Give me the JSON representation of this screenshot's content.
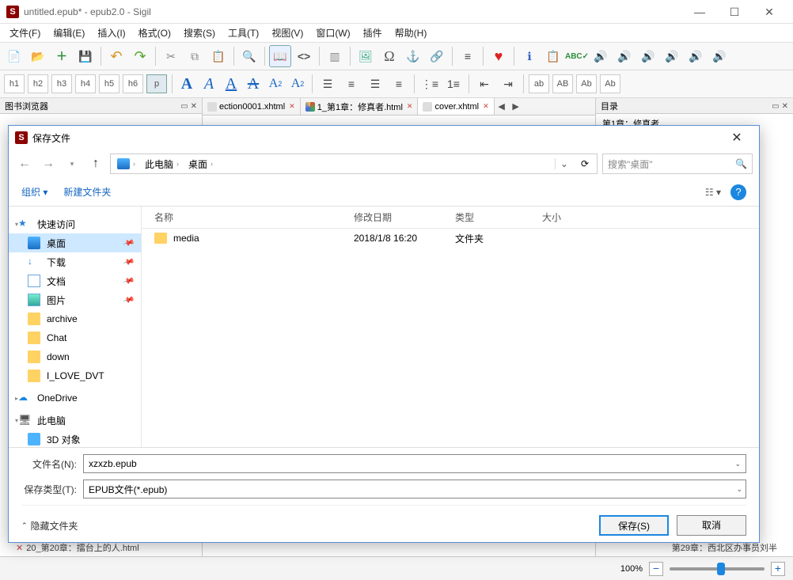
{
  "titlebar": {
    "title": "untitled.epub* - epub2.0 - Sigil",
    "logo": "S"
  },
  "menubar": {
    "file": "文件(F)",
    "edit": "编辑(E)",
    "insert": "插入(I)",
    "format": "格式(O)",
    "search": "搜索(S)",
    "tools": "工具(T)",
    "view": "视图(V)",
    "window": "窗口(W)",
    "plugins": "插件",
    "help": "帮助(H)"
  },
  "headings": {
    "h1": "h1",
    "h2": "h2",
    "h3": "h3",
    "h4": "h4",
    "h5": "h5",
    "h6": "h6",
    "p": "p"
  },
  "panes": {
    "bookbrowser": "图书浏览器",
    "toc": "目录",
    "toc_item": "第1章：修真者"
  },
  "tabs": [
    {
      "label": "ection0001.xhtml",
      "closable": true
    },
    {
      "label": "1_第1章：修真者.html",
      "closable": true
    },
    {
      "label": "cover.xhtml",
      "closable": true,
      "active": true
    }
  ],
  "partial": {
    "left": "20_第20章：擂台上的人.html",
    "right": "第29章：西北区办事员刘半"
  },
  "statusbar": {
    "zoom": "100%"
  },
  "dialog": {
    "title": "保存文件",
    "breadcrumb": {
      "root": "此电脑",
      "folder": "桌面"
    },
    "search_placeholder": "搜索\"桌面\"",
    "toolbar": {
      "organize": "组织",
      "newfolder": "新建文件夹"
    },
    "sidebar": {
      "quickaccess": "快速访问",
      "items": [
        {
          "label": "桌面",
          "icon": "desktop2",
          "pinned": true,
          "selected": true
        },
        {
          "label": "下载",
          "icon": "down",
          "pinned": true
        },
        {
          "label": "文档",
          "icon": "doc",
          "pinned": true
        },
        {
          "label": "图片",
          "icon": "pic",
          "pinned": true
        },
        {
          "label": "archive",
          "icon": "folder"
        },
        {
          "label": "Chat",
          "icon": "folder"
        },
        {
          "label": "down",
          "icon": "folder"
        },
        {
          "label": "I_LOVE_DVT",
          "icon": "folder"
        }
      ],
      "onedrive": "OneDrive",
      "thispc": "此电脑",
      "obj3d": "3D 对象"
    },
    "columns": {
      "name": "名称",
      "modified": "修改日期",
      "type": "类型",
      "size": "大小"
    },
    "files": [
      {
        "name": "media",
        "modified": "2018/1/8 16:20",
        "type": "文件夹",
        "size": ""
      }
    ],
    "filename_label": "文件名(N):",
    "filename_value": "xzxzb.epub",
    "filetype_label": "保存类型(T):",
    "filetype_value": "EPUB文件(*.epub)",
    "hide_folders": "隐藏文件夹",
    "save_btn": "保存(S)",
    "cancel_btn": "取消"
  }
}
